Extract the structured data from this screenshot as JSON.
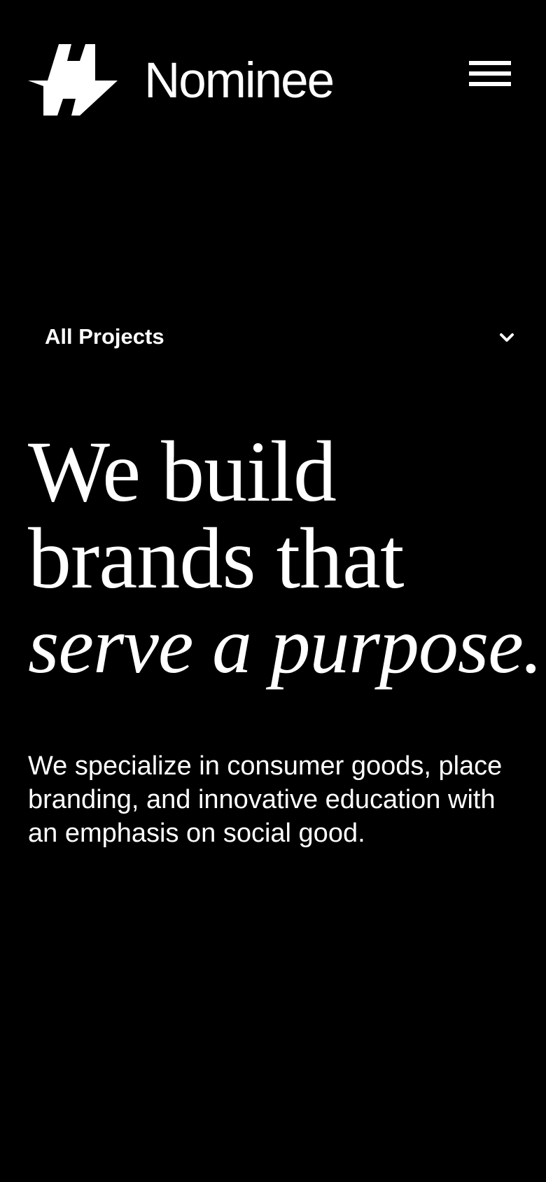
{
  "brand": {
    "name": "Nominee",
    "logo_icon": "double-lightning-logo-mark"
  },
  "header": {
    "menu_icon": "hamburger-menu-icon"
  },
  "filter": {
    "selected": "All Projects",
    "icon": "chevron-down-icon"
  },
  "hero": {
    "line1": "We build",
    "line2": "brands that",
    "line3": "serve a purpose."
  },
  "intro": {
    "text": "We specialize in consumer goods, place branding, and innovative education with an emphasis on social good."
  },
  "colors": {
    "background": "#000000",
    "foreground": "#ffffff"
  }
}
